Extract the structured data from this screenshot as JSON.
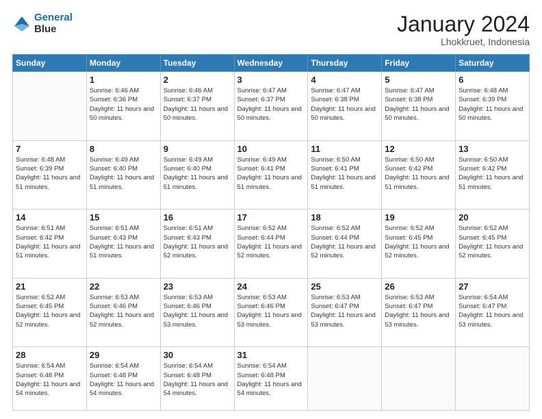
{
  "header": {
    "logo_line1": "General",
    "logo_line2": "Blue",
    "month_title": "January 2024",
    "location": "Lhokkruet, Indonesia"
  },
  "weekdays": [
    "Sunday",
    "Monday",
    "Tuesday",
    "Wednesday",
    "Thursday",
    "Friday",
    "Saturday"
  ],
  "weeks": [
    [
      {
        "day": "",
        "sunrise": "",
        "sunset": "",
        "daylight": ""
      },
      {
        "day": "1",
        "sunrise": "Sunrise: 6:46 AM",
        "sunset": "Sunset: 6:36 PM",
        "daylight": "Daylight: 11 hours and 50 minutes."
      },
      {
        "day": "2",
        "sunrise": "Sunrise: 6:46 AM",
        "sunset": "Sunset: 6:37 PM",
        "daylight": "Daylight: 11 hours and 50 minutes."
      },
      {
        "day": "3",
        "sunrise": "Sunrise: 6:47 AM",
        "sunset": "Sunset: 6:37 PM",
        "daylight": "Daylight: 11 hours and 50 minutes."
      },
      {
        "day": "4",
        "sunrise": "Sunrise: 6:47 AM",
        "sunset": "Sunset: 6:38 PM",
        "daylight": "Daylight: 11 hours and 50 minutes."
      },
      {
        "day": "5",
        "sunrise": "Sunrise: 6:47 AM",
        "sunset": "Sunset: 6:38 PM",
        "daylight": "Daylight: 11 hours and 50 minutes."
      },
      {
        "day": "6",
        "sunrise": "Sunrise: 6:48 AM",
        "sunset": "Sunset: 6:39 PM",
        "daylight": "Daylight: 11 hours and 50 minutes."
      }
    ],
    [
      {
        "day": "7",
        "sunrise": "Sunrise: 6:48 AM",
        "sunset": "Sunset: 6:39 PM",
        "daylight": "Daylight: 11 hours and 51 minutes."
      },
      {
        "day": "8",
        "sunrise": "Sunrise: 6:49 AM",
        "sunset": "Sunset: 6:40 PM",
        "daylight": "Daylight: 11 hours and 51 minutes."
      },
      {
        "day": "9",
        "sunrise": "Sunrise: 6:49 AM",
        "sunset": "Sunset: 6:40 PM",
        "daylight": "Daylight: 11 hours and 51 minutes."
      },
      {
        "day": "10",
        "sunrise": "Sunrise: 6:49 AM",
        "sunset": "Sunset: 6:41 PM",
        "daylight": "Daylight: 11 hours and 51 minutes."
      },
      {
        "day": "11",
        "sunrise": "Sunrise: 6:50 AM",
        "sunset": "Sunset: 6:41 PM",
        "daylight": "Daylight: 11 hours and 51 minutes."
      },
      {
        "day": "12",
        "sunrise": "Sunrise: 6:50 AM",
        "sunset": "Sunset: 6:42 PM",
        "daylight": "Daylight: 11 hours and 51 minutes."
      },
      {
        "day": "13",
        "sunrise": "Sunrise: 6:50 AM",
        "sunset": "Sunset: 6:42 PM",
        "daylight": "Daylight: 11 hours and 51 minutes."
      }
    ],
    [
      {
        "day": "14",
        "sunrise": "Sunrise: 6:51 AM",
        "sunset": "Sunset: 6:42 PM",
        "daylight": "Daylight: 11 hours and 51 minutes."
      },
      {
        "day": "15",
        "sunrise": "Sunrise: 6:51 AM",
        "sunset": "Sunset: 6:43 PM",
        "daylight": "Daylight: 11 hours and 51 minutes."
      },
      {
        "day": "16",
        "sunrise": "Sunrise: 6:51 AM",
        "sunset": "Sunset: 6:43 PM",
        "daylight": "Daylight: 11 hours and 52 minutes."
      },
      {
        "day": "17",
        "sunrise": "Sunrise: 6:52 AM",
        "sunset": "Sunset: 6:44 PM",
        "daylight": "Daylight: 11 hours and 52 minutes."
      },
      {
        "day": "18",
        "sunrise": "Sunrise: 6:52 AM",
        "sunset": "Sunset: 6:44 PM",
        "daylight": "Daylight: 11 hours and 52 minutes."
      },
      {
        "day": "19",
        "sunrise": "Sunrise: 6:52 AM",
        "sunset": "Sunset: 6:45 PM",
        "daylight": "Daylight: 11 hours and 52 minutes."
      },
      {
        "day": "20",
        "sunrise": "Sunrise: 6:52 AM",
        "sunset": "Sunset: 6:45 PM",
        "daylight": "Daylight: 11 hours and 52 minutes."
      }
    ],
    [
      {
        "day": "21",
        "sunrise": "Sunrise: 6:52 AM",
        "sunset": "Sunset: 6:45 PM",
        "daylight": "Daylight: 11 hours and 52 minutes."
      },
      {
        "day": "22",
        "sunrise": "Sunrise: 6:53 AM",
        "sunset": "Sunset: 6:46 PM",
        "daylight": "Daylight: 11 hours and 52 minutes."
      },
      {
        "day": "23",
        "sunrise": "Sunrise: 6:53 AM",
        "sunset": "Sunset: 6:46 PM",
        "daylight": "Daylight: 11 hours and 53 minutes."
      },
      {
        "day": "24",
        "sunrise": "Sunrise: 6:53 AM",
        "sunset": "Sunset: 6:46 PM",
        "daylight": "Daylight: 11 hours and 53 minutes."
      },
      {
        "day": "25",
        "sunrise": "Sunrise: 6:53 AM",
        "sunset": "Sunset: 6:47 PM",
        "daylight": "Daylight: 11 hours and 53 minutes."
      },
      {
        "day": "26",
        "sunrise": "Sunrise: 6:53 AM",
        "sunset": "Sunset: 6:47 PM",
        "daylight": "Daylight: 11 hours and 53 minutes."
      },
      {
        "day": "27",
        "sunrise": "Sunrise: 6:54 AM",
        "sunset": "Sunset: 6:47 PM",
        "daylight": "Daylight: 11 hours and 53 minutes."
      }
    ],
    [
      {
        "day": "28",
        "sunrise": "Sunrise: 6:54 AM",
        "sunset": "Sunset: 6:48 PM",
        "daylight": "Daylight: 11 hours and 54 minutes."
      },
      {
        "day": "29",
        "sunrise": "Sunrise: 6:54 AM",
        "sunset": "Sunset: 6:48 PM",
        "daylight": "Daylight: 11 hours and 54 minutes."
      },
      {
        "day": "30",
        "sunrise": "Sunrise: 6:54 AM",
        "sunset": "Sunset: 6:48 PM",
        "daylight": "Daylight: 11 hours and 54 minutes."
      },
      {
        "day": "31",
        "sunrise": "Sunrise: 6:54 AM",
        "sunset": "Sunset: 6:48 PM",
        "daylight": "Daylight: 11 hours and 54 minutes."
      },
      {
        "day": "",
        "sunrise": "",
        "sunset": "",
        "daylight": ""
      },
      {
        "day": "",
        "sunrise": "",
        "sunset": "",
        "daylight": ""
      },
      {
        "day": "",
        "sunrise": "",
        "sunset": "",
        "daylight": ""
      }
    ]
  ]
}
